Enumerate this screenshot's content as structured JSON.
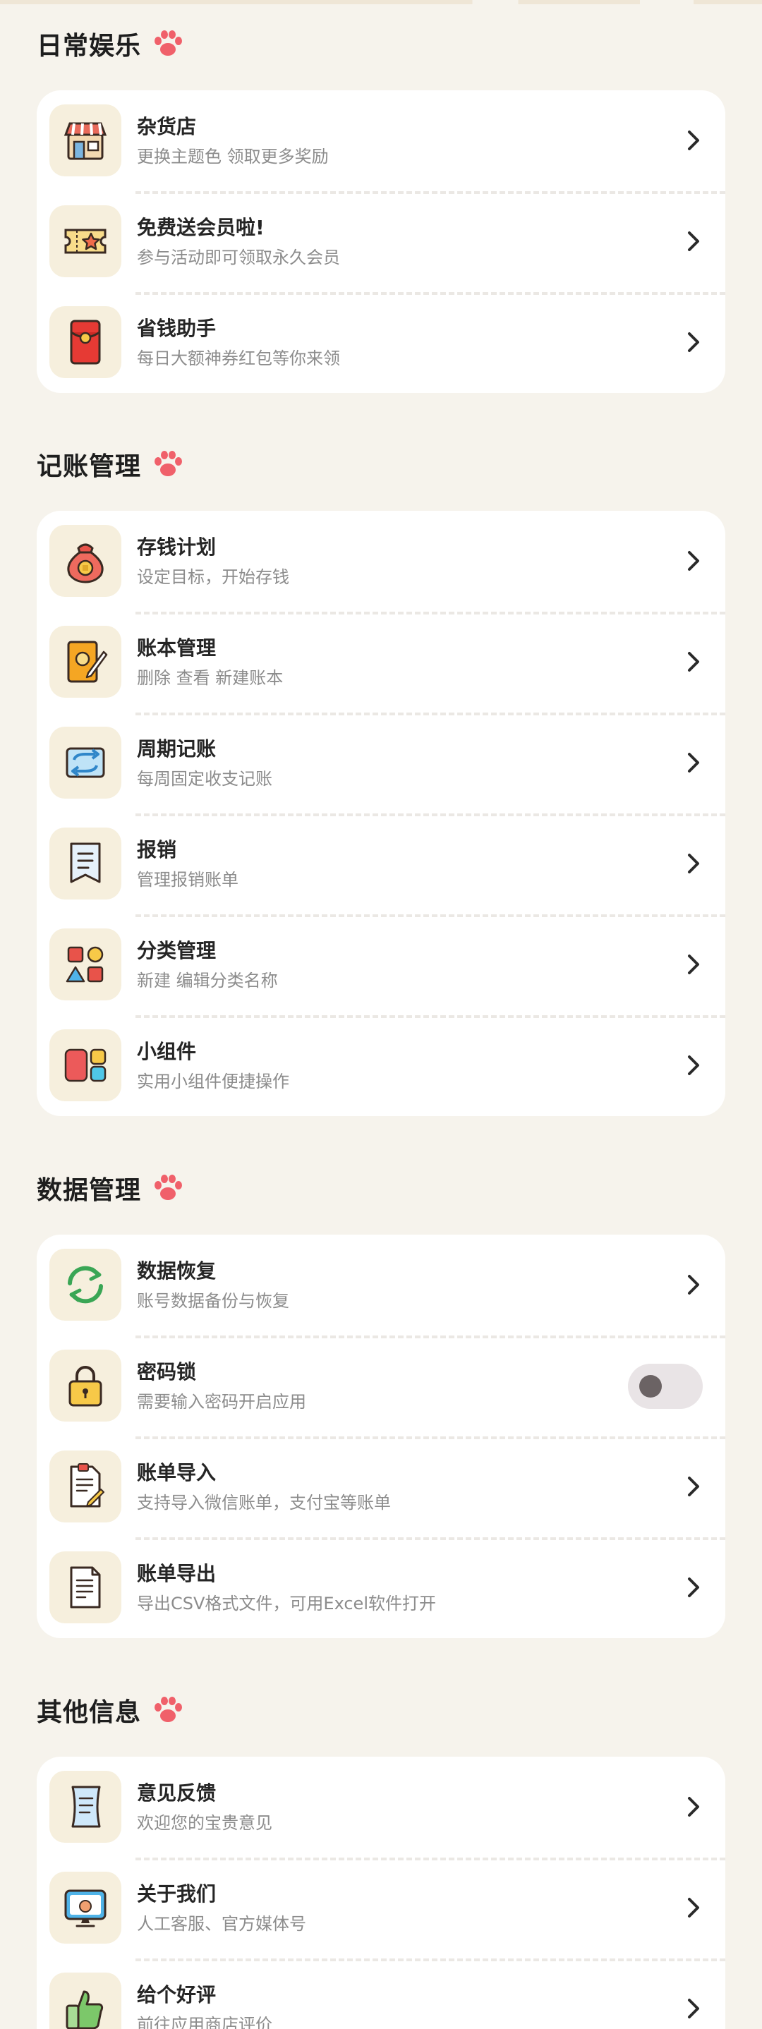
{
  "sections": [
    {
      "title": "日常娱乐",
      "items": [
        {
          "icon": "shop-icon",
          "title": "杂货店",
          "subtitle": "更换主题色 领取更多奖励"
        },
        {
          "icon": "ticket-star-icon",
          "title": "免费送会员啦!",
          "subtitle": "参与活动即可领取永久会员"
        },
        {
          "icon": "red-envelope-icon",
          "title": "省钱助手",
          "subtitle": "每日大额神券红包等你来领"
        }
      ]
    },
    {
      "title": "记账管理",
      "items": [
        {
          "icon": "money-bag-icon",
          "title": "存钱计划",
          "subtitle": "设定目标，开始存钱"
        },
        {
          "icon": "notebook-pen-icon",
          "title": "账本管理",
          "subtitle": "删除 查看 新建账本"
        },
        {
          "icon": "repeat-icon",
          "title": "周期记账",
          "subtitle": "每周固定收支记账"
        },
        {
          "icon": "receipt-icon",
          "title": "报销",
          "subtitle": "管理报销账单"
        },
        {
          "icon": "shapes-icon",
          "title": "分类管理",
          "subtitle": "新建 编辑分类名称"
        },
        {
          "icon": "widget-icon",
          "title": "小组件",
          "subtitle": "实用小组件便捷操作"
        }
      ]
    },
    {
      "title": "数据管理",
      "items": [
        {
          "icon": "sync-icon",
          "title": "数据恢复",
          "subtitle": "账号数据备份与恢复"
        },
        {
          "icon": "padlock-icon",
          "title": "密码锁",
          "subtitle": "需要输入密码开启应用",
          "toggle_on": false
        },
        {
          "icon": "import-document-icon",
          "title": "账单导入",
          "subtitle": "支持导入微信账单，支付宝等账单"
        },
        {
          "icon": "export-document-icon",
          "title": "账单导出",
          "subtitle": "导出CSV格式文件，可用Excel软件打开"
        }
      ]
    },
    {
      "title": "其他信息",
      "items": [
        {
          "icon": "feedback-scroll-icon",
          "title": "意见反馈",
          "subtitle": "欢迎您的宝贵意见"
        },
        {
          "icon": "monitor-icon",
          "title": "关于我们",
          "subtitle": "人工客服、官方媒体号"
        },
        {
          "icon": "thumbs-up-icon",
          "title": "给个好评",
          "subtitle": "前往应用商店评价"
        }
      ]
    }
  ],
  "colors": {
    "background": "#f6f3ec",
    "card": "#ffffff",
    "icon_tile": "#f6efdd",
    "paw": "#f0606a",
    "title_text": "#252525",
    "subtitle_text": "#8c8c8c"
  }
}
